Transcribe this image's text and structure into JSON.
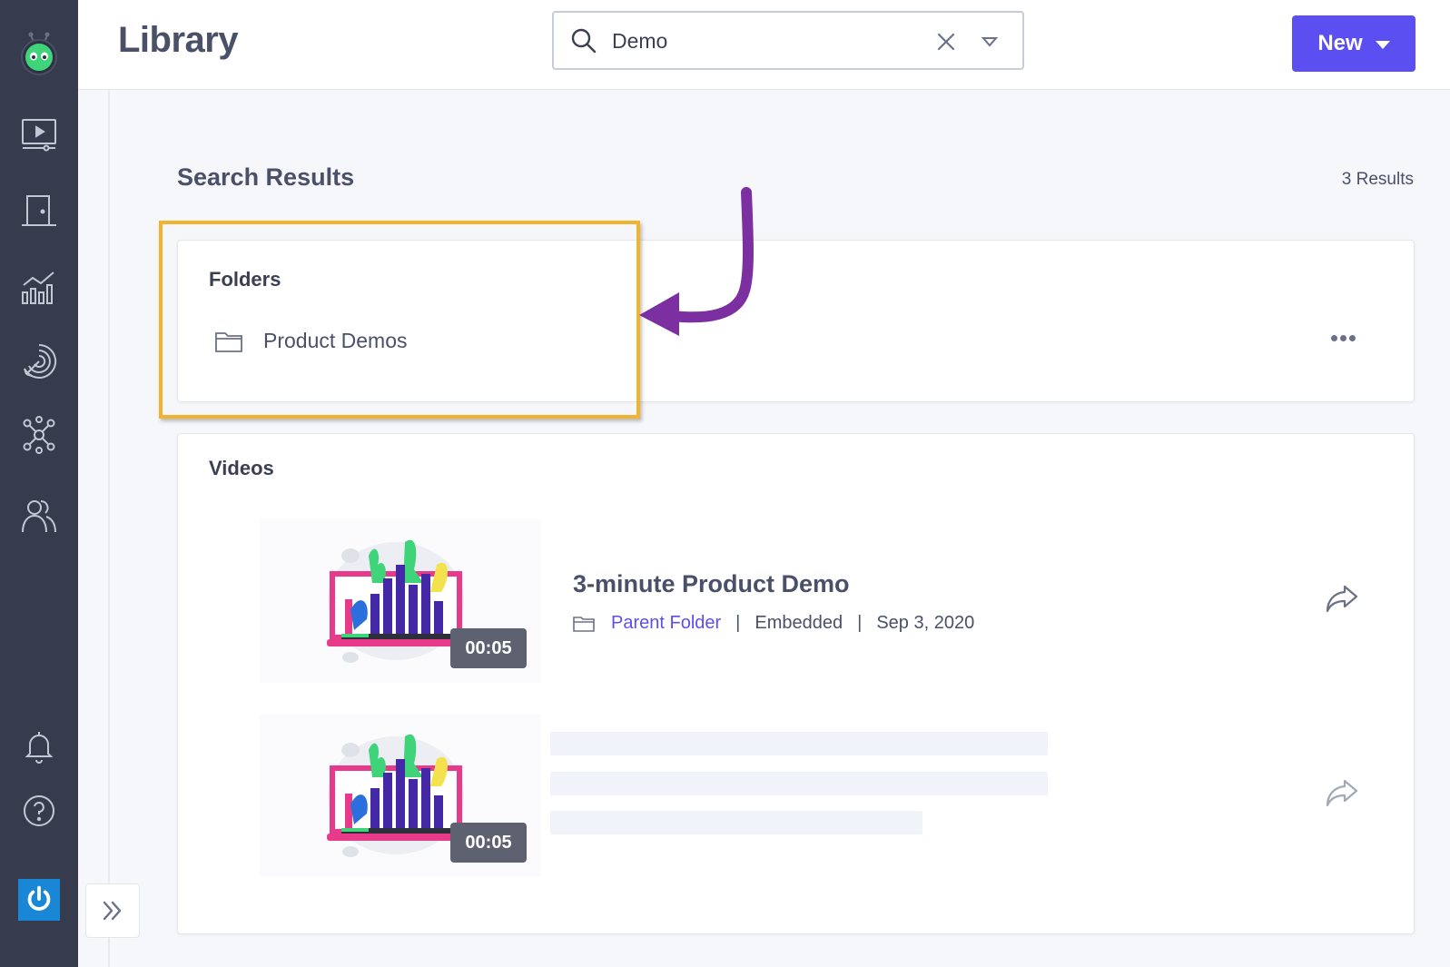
{
  "header": {
    "title": "Library",
    "search_value": "Demo",
    "new_button_label": "New"
  },
  "rail": {
    "items": [
      "videos-icon",
      "door-icon",
      "analytics-icon",
      "target-icon",
      "network-icon",
      "users-icon",
      "bell-icon",
      "help-icon"
    ]
  },
  "results": {
    "title": "Search Results",
    "count": "3 Results"
  },
  "folders": {
    "label": "Folders",
    "items": [
      {
        "name": "Product Demos"
      }
    ]
  },
  "videos": {
    "label": "Videos",
    "items": [
      {
        "title": "3-minute Product Demo",
        "folder": "Parent Folder",
        "status": "Embedded",
        "date": "Sep 3, 2020",
        "duration": "00:05"
      },
      {
        "duration": "00:05"
      }
    ]
  },
  "colors": {
    "rail_bg": "#363b4d",
    "accent": "#5b4ff2",
    "highlight": "#f2b42c",
    "annotation_arrow": "#7b2fa0"
  }
}
